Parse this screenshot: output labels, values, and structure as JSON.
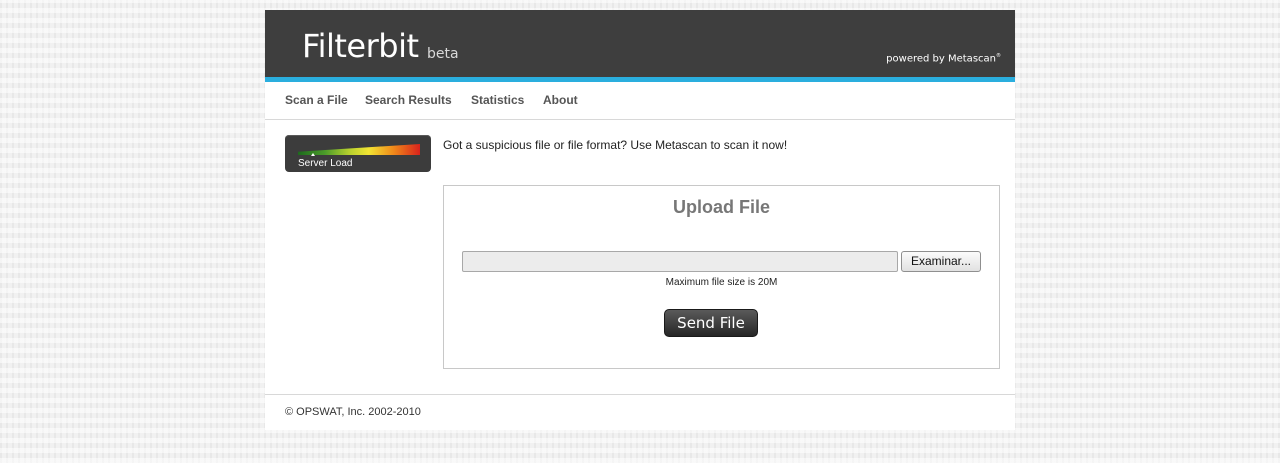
{
  "header": {
    "logo": "Filterbit",
    "logo_suffix": "beta",
    "powered_by": "powered by Metascan",
    "trademark": "®"
  },
  "nav": {
    "items": [
      {
        "label": "Scan a File"
      },
      {
        "label": "Search Results"
      },
      {
        "label": "Statistics"
      },
      {
        "label": "About"
      }
    ]
  },
  "server_load": {
    "label": "Server Load",
    "level": 0.12
  },
  "intro": "Got a suspicious file or file format? Use Metascan to scan it now!",
  "upload": {
    "title": "Upload File",
    "file_value": "",
    "browse_label": "Examinar...",
    "max_size_note": "Maximum file size is 20M",
    "send_label": "Send File"
  },
  "colors": {
    "header_bg": "#3e3e3e",
    "accent": "#2aaede"
  },
  "footer": {
    "copyright": "© OPSWAT, Inc. 2002-2010"
  }
}
